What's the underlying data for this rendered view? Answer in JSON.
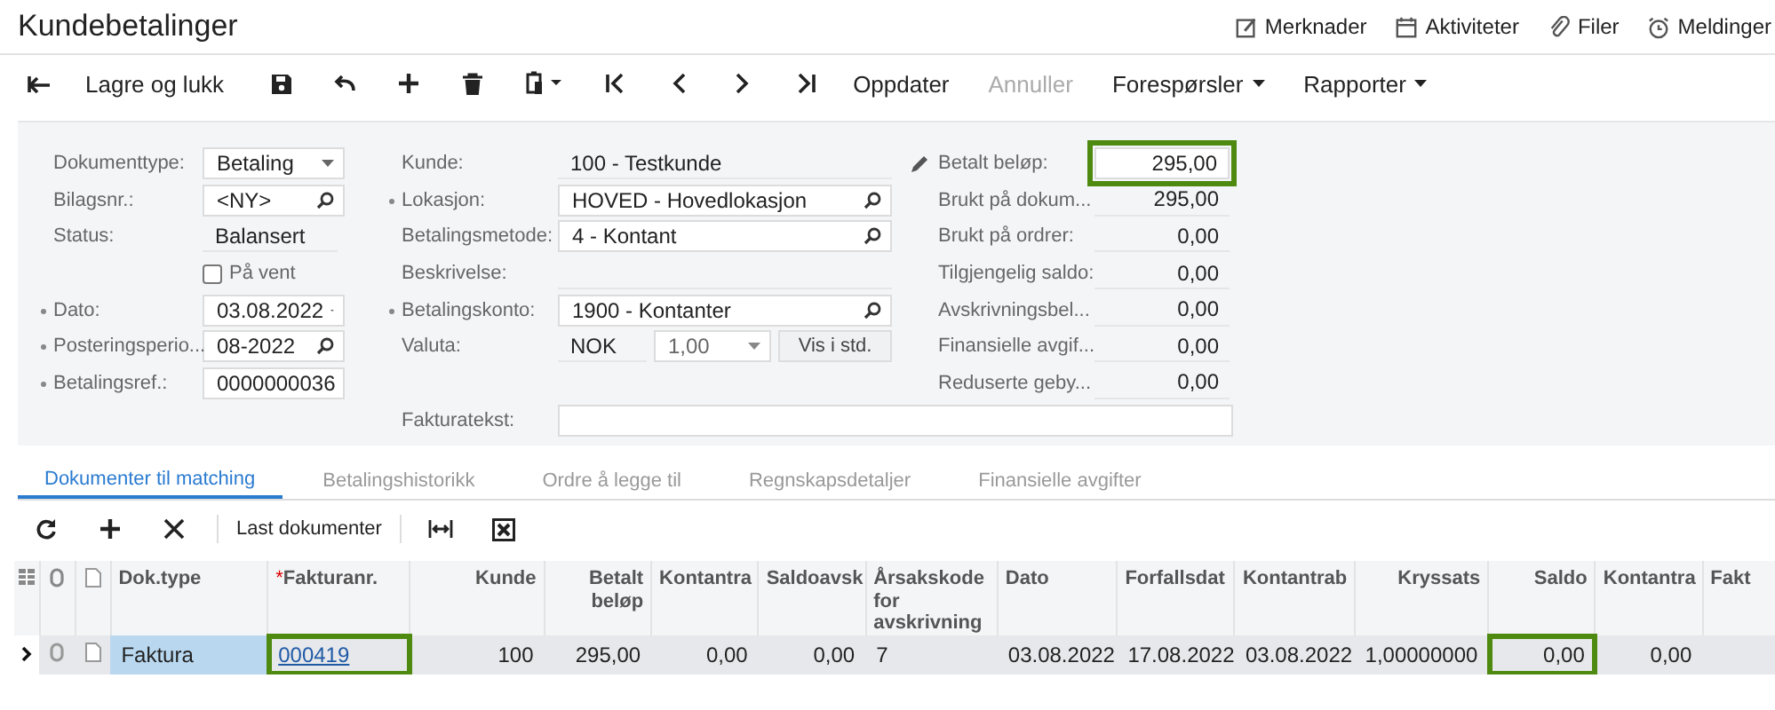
{
  "window": {
    "title": "Kundebetalinger"
  },
  "header_links": [
    {
      "label": "Merknader"
    },
    {
      "label": "Aktiviteter"
    },
    {
      "label": "Filer"
    },
    {
      "label": "Meldinger"
    }
  ],
  "toolbar": [
    {
      "label": "Lagre og lukk",
      "disabled": false,
      "menu": false
    },
    {
      "label": "Oppdater",
      "disabled": false,
      "menu": false
    },
    {
      "label": "Annuller",
      "disabled": true,
      "menu": false
    },
    {
      "label": "Forespørsler",
      "disabled": false,
      "menu": true
    },
    {
      "label": "Rapporter",
      "disabled": false,
      "menu": true
    }
  ],
  "form": {
    "left": [
      {
        "kind": "dropdown",
        "label": "Dokumenttype:",
        "required": false,
        "value": "Betaling"
      },
      {
        "kind": "lookup",
        "label": "Bilagsnr.:",
        "required": false,
        "value": "<NY>"
      },
      {
        "kind": "readonly",
        "label": "Status:",
        "required": false,
        "value": "Balansert"
      },
      {
        "kind": "checkbox",
        "label": "På vent",
        "required": false,
        "checked": false
      },
      {
        "kind": "dropdown",
        "label": "Dato:",
        "required": true,
        "value": "03.08.2022"
      },
      {
        "kind": "lookup",
        "label": "Posteringsperio...",
        "required": true,
        "value": "08-2022"
      },
      {
        "kind": "input",
        "label": "Betalingsref.:",
        "required": true,
        "value": "0000000036"
      }
    ],
    "middle": [
      {
        "kind": "readonly",
        "label": "Kunde:",
        "required": false,
        "value": "100 - Testkunde"
      },
      {
        "kind": "lookup",
        "label": "Lokasjon:",
        "required": true,
        "value": "HOVED - Hovedlokasjon"
      },
      {
        "kind": "lookup",
        "label": "Betalingsmetode:",
        "required": false,
        "value": "4 - Kontant"
      },
      {
        "kind": "readonly",
        "label": "Beskrivelse:",
        "required": false
      },
      {
        "kind": "lookup",
        "label": "Betalingskonto:",
        "required": true,
        "value": "1900 - Kontanter"
      },
      {
        "kind": "currency",
        "label": "Valuta:",
        "required": false,
        "value": "NOK",
        "rate": "1,00",
        "button": "Vis i std."
      }
    ],
    "summary": [
      {
        "label": "Betalt beløp:",
        "value": "295,00",
        "highlighted": true,
        "editable": true
      },
      {
        "label": "Brukt på dokum...",
        "value": "295,00",
        "highlighted": false,
        "editable": false
      },
      {
        "label": "Brukt på ordrer:",
        "value": "0,00",
        "highlighted": false,
        "editable": false
      },
      {
        "label": "Tilgjengelig saldo:",
        "value": "0,00",
        "highlighted": false,
        "editable": false
      },
      {
        "label": "Avskrivningsbel...",
        "value": "0,00",
        "highlighted": false,
        "editable": false
      },
      {
        "label": "Finansielle avgif...",
        "value": "0,00",
        "highlighted": false,
        "editable": false
      },
      {
        "label": "Reduserte geby...",
        "value": "0,00",
        "highlighted": false,
        "editable": false
      }
    ],
    "invoice_text": {
      "label": "Fakturatekst:"
    }
  },
  "tabs": [
    {
      "label": "Dokumenter til matching",
      "selected": true
    },
    {
      "label": "Betalingshistorikk",
      "selected": false
    },
    {
      "label": "Ordre å legge til",
      "selected": false
    },
    {
      "label": "Regnskapsdetaljer",
      "selected": false
    },
    {
      "label": "Finansielle avgifter",
      "selected": false
    }
  ],
  "grid_toolbar": {
    "load_button": "Last dokumenter"
  },
  "table": {
    "columns": [
      {
        "label": "Dok.type"
      },
      {
        "label": "Fakturanr.",
        "required_mark": "*"
      },
      {
        "label": "Kunde"
      },
      {
        "label": "Betalt beløp"
      },
      {
        "label": "Kontantra"
      },
      {
        "label": "Saldoavsk"
      },
      {
        "label": "Årsakskode for avskrivning"
      },
      {
        "label": "Dato"
      },
      {
        "label": "Forfallsdat"
      },
      {
        "label": "Kontantrab"
      },
      {
        "label": "Kryssats"
      },
      {
        "label": "Saldo"
      },
      {
        "label": "Kontantra"
      },
      {
        "label": "Fakt"
      }
    ],
    "rows": [
      {
        "selected": true,
        "cells": [
          {
            "text": "Faktura",
            "active": true,
            "highlighted": false,
            "link": false
          },
          {
            "text": "000419",
            "active": false,
            "highlighted": true,
            "link": true
          },
          {
            "text": "100",
            "active": false,
            "highlighted": false,
            "link": false
          },
          {
            "text": "295,00",
            "active": false,
            "highlighted": false,
            "link": false
          },
          {
            "text": "0,00",
            "active": false,
            "highlighted": false,
            "link": false
          },
          {
            "text": "0,00",
            "active": false,
            "highlighted": false,
            "link": false
          },
          {
            "text": "7",
            "active": false,
            "highlighted": false,
            "link": false
          },
          {
            "text": "03.08.2022",
            "active": false,
            "highlighted": false,
            "link": false
          },
          {
            "text": "17.08.2022",
            "active": false,
            "highlighted": false,
            "link": false
          },
          {
            "text": "03.08.2022",
            "active": false,
            "highlighted": false,
            "link": false
          },
          {
            "text": "1,00000000",
            "active": false,
            "highlighted": false,
            "link": false
          },
          {
            "text": "0,00",
            "active": false,
            "highlighted": true,
            "link": false
          },
          {
            "text": "0,00",
            "active": false,
            "highlighted": false,
            "link": false
          }
        ]
      }
    ]
  }
}
